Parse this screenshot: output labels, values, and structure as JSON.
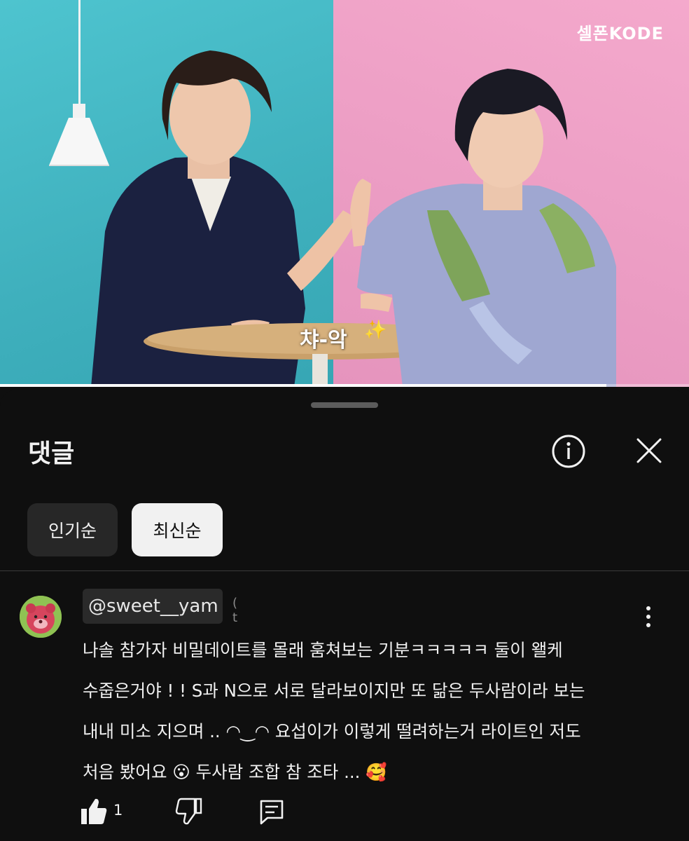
{
  "video": {
    "brand_logo": "셀폰KODE",
    "caption": "챠-악",
    "sparkle_icon": "sparkles-icon",
    "progress_fraction": 0.88,
    "colors": {
      "wall_left": "#4ec4cf",
      "wall_right": "#f4a9cc"
    }
  },
  "comments_panel": {
    "title": "댓글",
    "info_icon": "info-icon",
    "close_icon": "close-icon",
    "sort_chips": [
      {
        "label": "인기순",
        "selected": false
      },
      {
        "label": "최신순",
        "selected": true
      }
    ]
  },
  "comment": {
    "author": "@sweet__yam",
    "author_tail": "(    t",
    "avatar_icon": "avatar-icon",
    "lines": [
      "나솔 참가자 비밀데이트를 몰래 훔쳐보는 기분ㅋㅋㅋㅋㅋ 둘이 왤케",
      "수줍은거야 ! ! S과 N으로 서로 달라보이지만 또 닮은 두사람이라 보는",
      "내내 미소 지으며 .. ◠‿◠ 요섭이가 이렇게 떨려하는거 라이트인 저도",
      "처음 봤어요 😮 두사람 조합 참 조타 ... 🥰"
    ],
    "like_count": "1",
    "like_icon": "thumbs-up-icon",
    "dislike_icon": "thumbs-down-icon",
    "reply_icon": "reply-icon",
    "more_icon": "more-vert-icon"
  }
}
